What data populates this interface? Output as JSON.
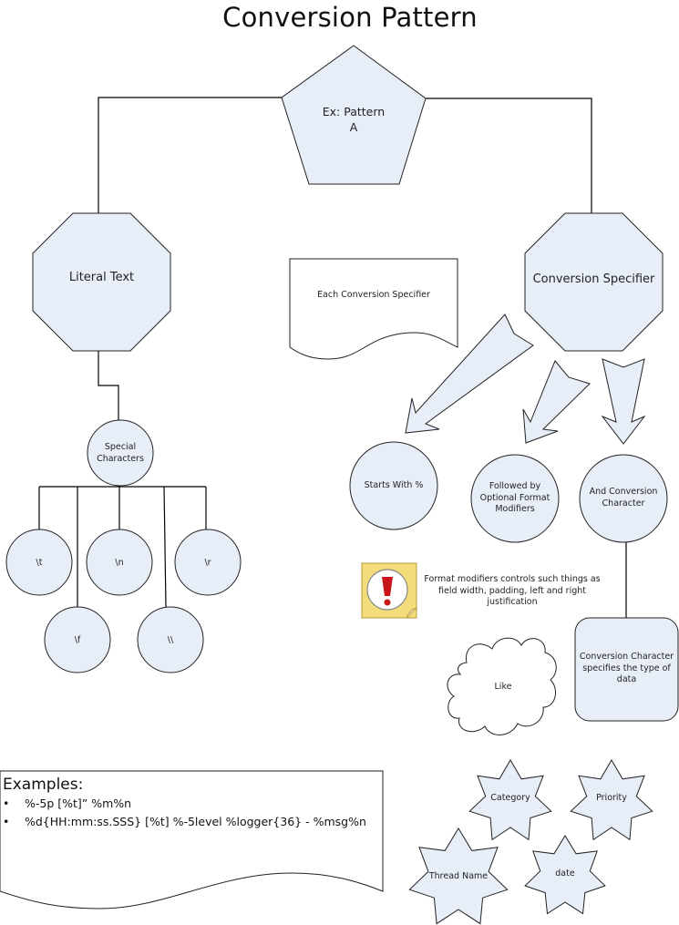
{
  "title": "Conversion Pattern",
  "colors": {
    "shape_fill": "#E8EEF8",
    "stroke": "#000000",
    "note_bg": "#F3DC7A",
    "note_exclaim": "#C8161B"
  },
  "root": {
    "label_line1": "Ex: Pattern",
    "label_line2": "A"
  },
  "literal_text": {
    "label": "Literal Text"
  },
  "conversion_specifier": {
    "label": "Conversion Specifier"
  },
  "each_doc": {
    "label": "Each Conversion Specifier"
  },
  "special_characters": {
    "label_line1": "Special",
    "label_line2": "Characters",
    "items": [
      "\\t",
      "\\n",
      "\\r",
      "\\f",
      "\\\\"
    ]
  },
  "parts": [
    {
      "label": "Starts With %"
    },
    {
      "label_lines": [
        "Followed by",
        "Optional Format",
        "Modifiers"
      ]
    },
    {
      "label_lines": [
        "And Conversion",
        "Character"
      ]
    }
  ],
  "note": {
    "icon": "exclamation-note-icon",
    "lines": [
      "Format modifiers controls such things as",
      "field width, padding, left and right",
      "justification"
    ]
  },
  "conversion_character_box": {
    "lines": [
      "Conversion Character",
      "specifies the type of",
      "data"
    ]
  },
  "like_cloud": {
    "label": "Like"
  },
  "data_types": [
    "Category",
    "Priority",
    "Thread Name",
    "date"
  ],
  "examples": {
    "heading": "Examples:",
    "items": [
      "%-5p [%t]” %m%n",
      "%d{HH:mm:ss.SSS} [%t] %-5level %logger{36} - %msg%n"
    ]
  }
}
